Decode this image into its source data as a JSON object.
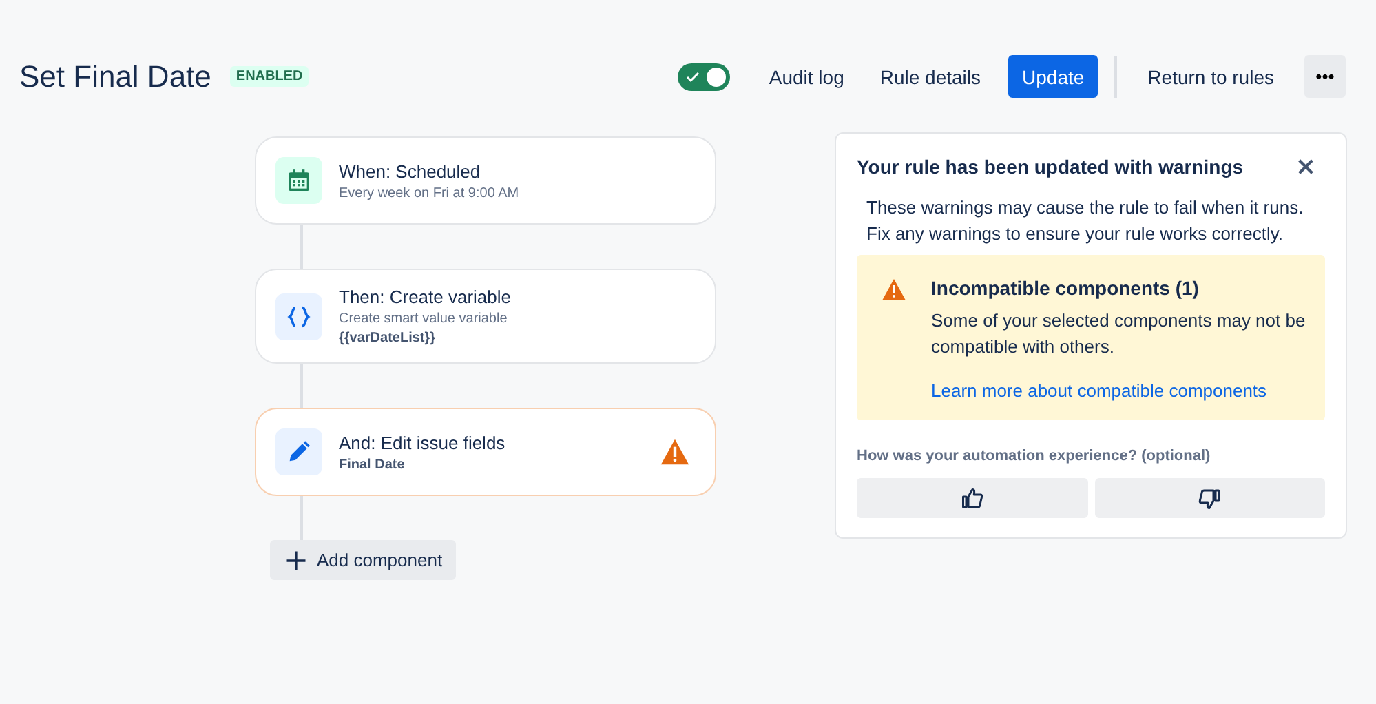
{
  "header": {
    "title": "Set Final Date",
    "status": "ENABLED",
    "toggle": {
      "on": true
    },
    "actions": [
      {
        "label": "Audit log",
        "kind": "link"
      },
      {
        "label": "Rule details",
        "kind": "link"
      },
      {
        "label": "Update",
        "kind": "primary"
      },
      {
        "label": "Return to rules",
        "kind": "link"
      }
    ],
    "more": "•••"
  },
  "components": [
    {
      "title": "When: Scheduled",
      "kind": "schedule",
      "lines": [
        "Every week on Fri at 9:00 AM"
      ],
      "warning": false
    },
    {
      "title": "Then: Create variable",
      "kind": "variable",
      "lines": [
        "Create smart value variable",
        "**{{varDateList}}**"
      ],
      "warning": false
    },
    {
      "title": "And: Edit issue fields",
      "kind": "edit",
      "lines": [
        "**Final Date**"
      ],
      "warning": true
    }
  ],
  "add_button": "Add component",
  "panel": {
    "title": "Your rule has been updated with warnings",
    "body": "These warnings may cause the rule to fail when it runs. Fix any warnings to ensure your rule works correctly.",
    "warning": {
      "title": "Incompatible components (1)",
      "text": "Some of your selected components may not be compatible with others.",
      "link": "Learn more about compatible components"
    },
    "feedback": "How was your automation experience? (optional)"
  }
}
